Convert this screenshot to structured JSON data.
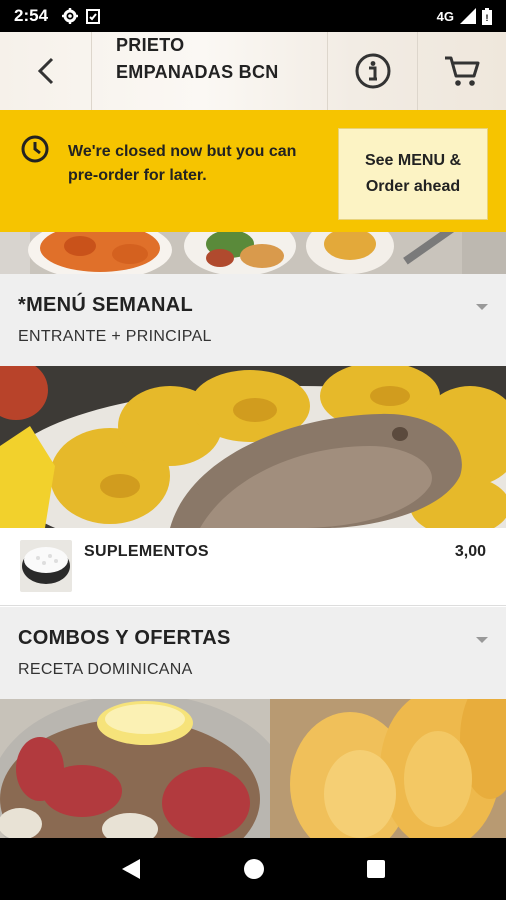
{
  "status_bar": {
    "time": "2:54",
    "network": "4G"
  },
  "header": {
    "title_line1": "PRIETO",
    "title_line2": "EMPANADAS BCN"
  },
  "banner": {
    "message": "We're closed now but you can pre-order for later.",
    "button_label": "See MENU & Order ahead"
  },
  "categories": [
    {
      "title": "*MENÚ SEMANAL",
      "subtitle": "ENTRANTE + PRINCIPAL",
      "items": [
        {
          "name": "SUPLEMENTOS",
          "price": "3,00"
        }
      ]
    },
    {
      "title": "COMBOS Y OFERTAS",
      "subtitle": "RECETA DOMINICANA"
    }
  ],
  "colors": {
    "accent": "#f6c400",
    "button_bg": "#fcf3c4",
    "section_bg": "#efefef"
  },
  "icons": [
    "settings-icon",
    "clipboard-icon",
    "signal-icon",
    "battery-icon",
    "back-arrow-icon",
    "info-icon",
    "cart-icon",
    "clock-icon",
    "chevron-down-icon",
    "nav-back-icon",
    "nav-home-icon",
    "nav-recents-icon"
  ]
}
